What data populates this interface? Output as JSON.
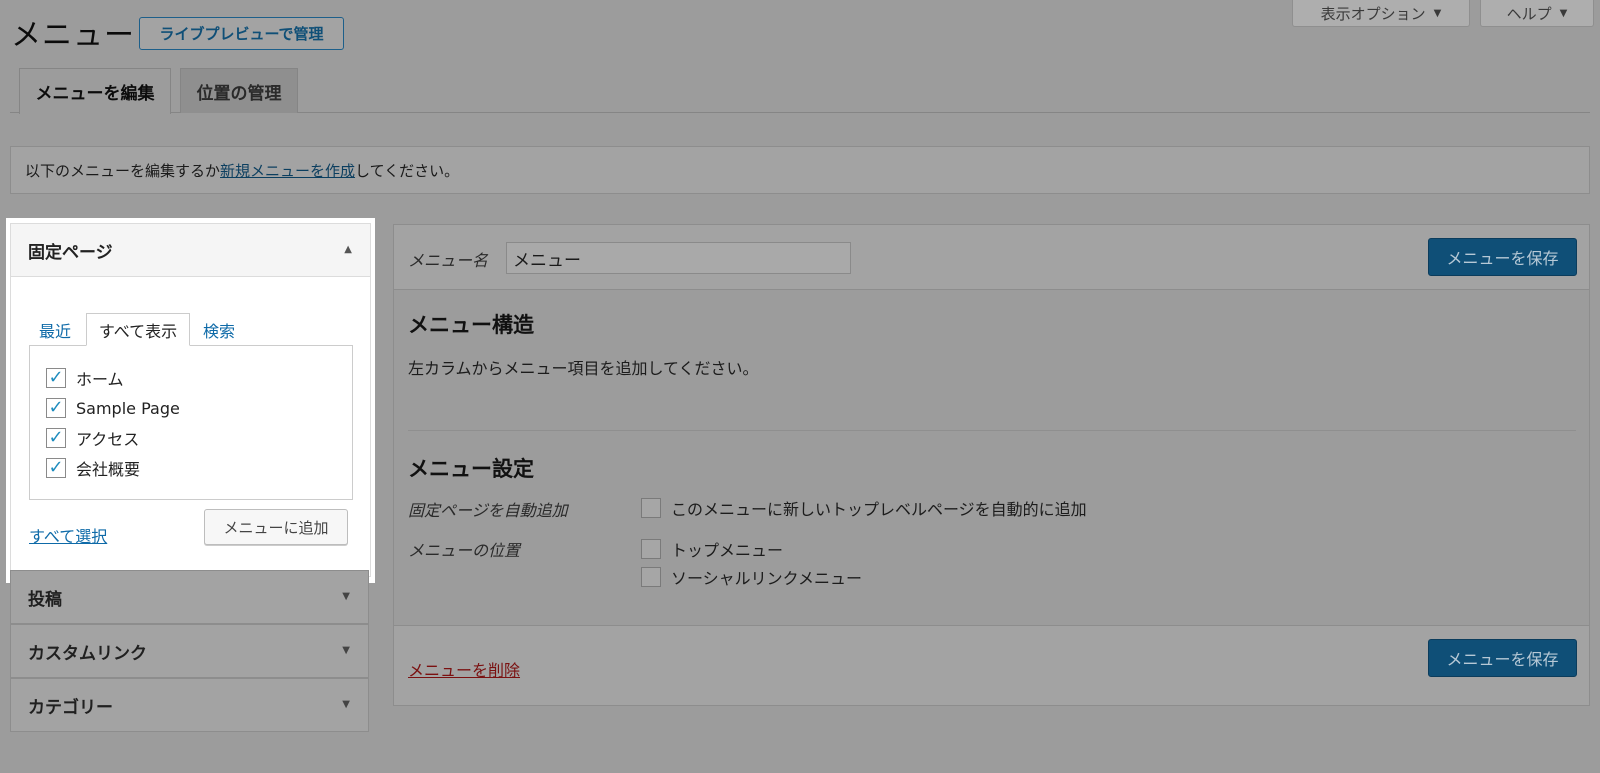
{
  "screen_meta": {
    "screen_options": "表示オプション",
    "help": "ヘルプ"
  },
  "heading": {
    "title": "メニュー",
    "live_preview": "ライブプレビューで管理"
  },
  "nav_tabs": [
    {
      "label": "メニューを編集",
      "active": true
    },
    {
      "label": "位置の管理",
      "active": false
    }
  ],
  "notice": {
    "prefix": "以下のメニューを編集するか",
    "link": "新規メニューを作成",
    "suffix": "してください。"
  },
  "pages_panel": {
    "title": "固定ページ",
    "tabs": [
      "最近",
      "すべて表示",
      "検索"
    ],
    "active_tab": "すべて表示",
    "items": [
      {
        "label": "ホーム",
        "checked": true
      },
      {
        "label": "Sample Page",
        "checked": true
      },
      {
        "label": "アクセス",
        "checked": true
      },
      {
        "label": "会社概要",
        "checked": true
      }
    ],
    "select_all": "すべて選択",
    "add_button": "メニューに追加"
  },
  "collapsed_sections": [
    {
      "label": "投稿"
    },
    {
      "label": "カスタムリンク"
    },
    {
      "label": "カテゴリー"
    }
  ],
  "menu_editor": {
    "name_label": "メニュー名",
    "name_value": "メニュー",
    "save_button": "メニューを保存",
    "structure_title": "メニュー構造",
    "structure_desc": "左カラムからメニュー項目を追加してください。",
    "settings_title": "メニュー設定",
    "auto_add_label": "固定ページを自動追加",
    "auto_add_option": "このメニューに新しいトップレベルページを自動的に追加",
    "position_label": "メニューの位置",
    "positions": [
      "トップメニュー",
      "ソーシャルリンクメニュー"
    ],
    "delete_link": "メニューを削除"
  },
  "colors": {
    "overlay_bg": "#9c9c9c",
    "primary_button": "#0f4f77",
    "link": "#0e6aa8",
    "checkbox_check": "#1e8cbe",
    "delete": "#7a1010"
  },
  "icons": {
    "dropdown": "triangle-down",
    "collapse": "triangle-up",
    "check": "checkmark"
  }
}
